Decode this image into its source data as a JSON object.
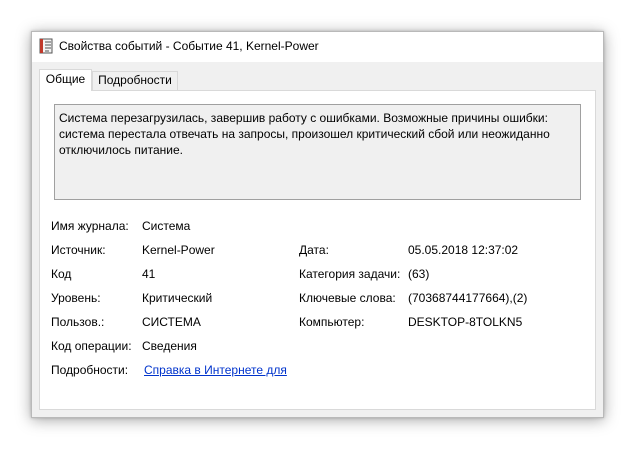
{
  "window": {
    "title": "Свойства событий - Событие 41, Kernel-Power",
    "icon": "event-log-icon"
  },
  "tabs": [
    {
      "label": "Общие",
      "active": true
    },
    {
      "label": "Подробности",
      "active": false
    }
  ],
  "message": "Система перезагрузилась, завершив работу с ошибками. Возможные причины ошибки: система перестала отвечать на запросы, произошел критический сбой или неожиданно отключилось питание.",
  "fields": {
    "log_name": {
      "label": "Имя журнала:",
      "value": "Система"
    },
    "source": {
      "label": "Источник:",
      "value": "Kernel-Power"
    },
    "date": {
      "label": "Дата:",
      "value": "05.05.2018 12:37:02"
    },
    "event_id": {
      "label": "Код",
      "value": "41"
    },
    "task_category": {
      "label": "Категория задачи:",
      "value": "(63)"
    },
    "level": {
      "label": "Уровень:",
      "value": "Критический"
    },
    "keywords": {
      "label": "Ключевые слова:",
      "value": "(70368744177664),(2)"
    },
    "user": {
      "label": "Пользов.:",
      "value": "СИСТЕМА"
    },
    "computer": {
      "label": "Компьютер:",
      "value": "DESKTOP-8TOLKN5"
    },
    "opcode": {
      "label": "Код операции:",
      "value": "Сведения"
    },
    "more_info": {
      "label": "Подробности:",
      "link": "Справка в Интернете для "
    }
  }
}
